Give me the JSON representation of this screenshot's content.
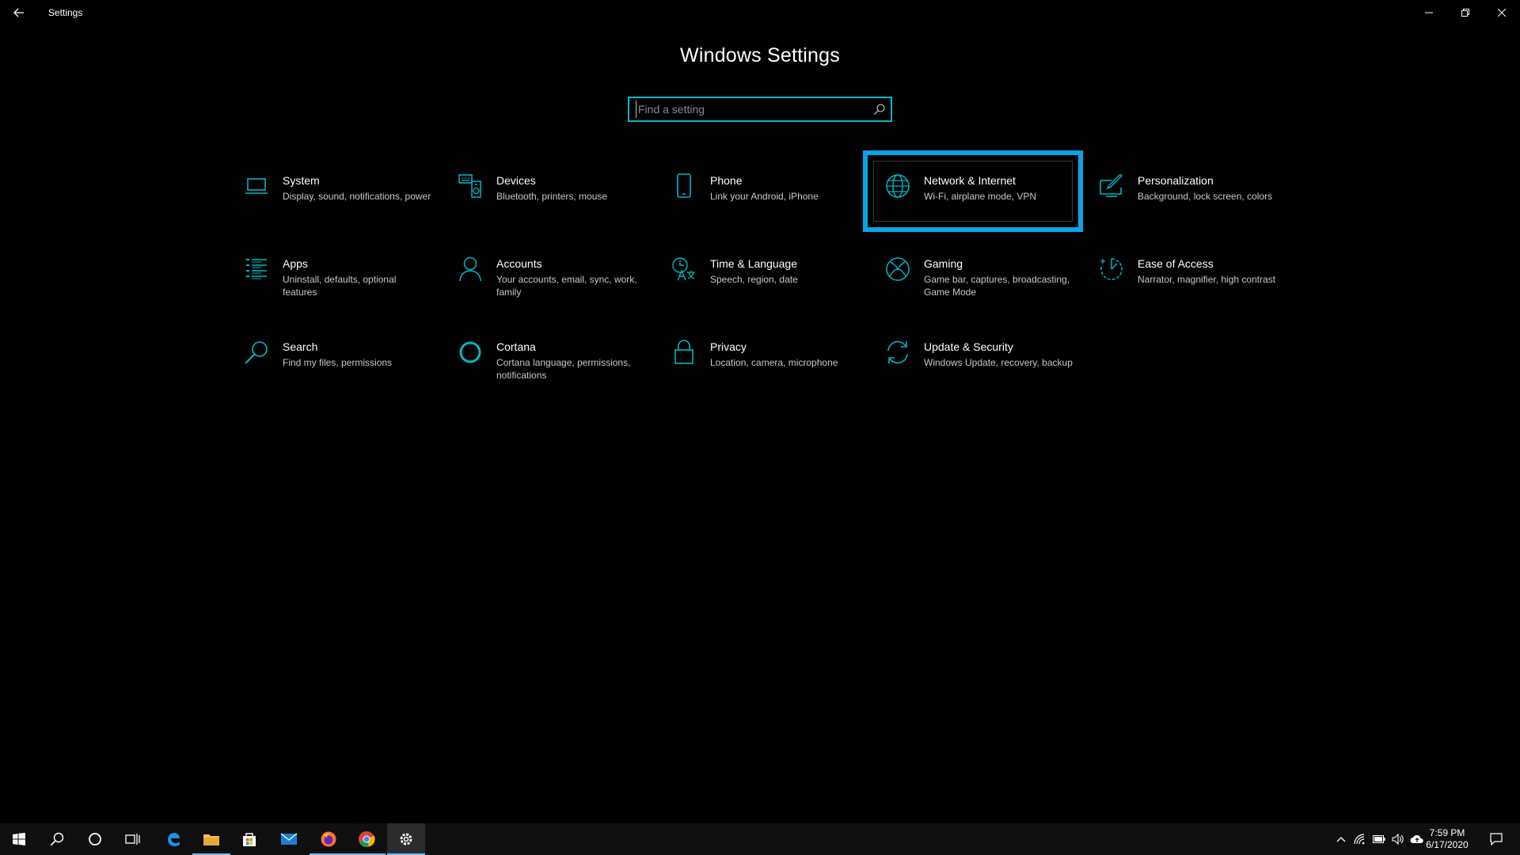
{
  "window": {
    "title": "Settings"
  },
  "page": {
    "heading": "Windows Settings",
    "search_placeholder": "Find a setting"
  },
  "categories": [
    {
      "name": "System",
      "desc": "Display, sound, notifications, power",
      "icon": "laptop-icon"
    },
    {
      "name": "Devices",
      "desc": "Bluetooth, printers, mouse",
      "icon": "keyboard-speaker-icon"
    },
    {
      "name": "Phone",
      "desc": "Link your Android, iPhone",
      "icon": "phone-icon"
    },
    {
      "name": "Network & Internet",
      "desc": "Wi-Fi, airplane mode, VPN",
      "icon": "globe-icon"
    },
    {
      "name": "Personalization",
      "desc": "Background, lock screen, colors",
      "icon": "pen-display-icon"
    },
    {
      "name": "Apps",
      "desc": "Uninstall, defaults, optional features",
      "icon": "list-icon"
    },
    {
      "name": "Accounts",
      "desc": "Your accounts, email, sync, work, family",
      "icon": "person-icon"
    },
    {
      "name": "Time & Language",
      "desc": "Speech, region, date",
      "icon": "time-language-icon"
    },
    {
      "name": "Gaming",
      "desc": "Game bar, captures, broadcasting, Game Mode",
      "icon": "xbox-icon"
    },
    {
      "name": "Ease of Access",
      "desc": "Narrator, magnifier, high contrast",
      "icon": "ease-of-access-icon"
    },
    {
      "name": "Search",
      "desc": "Find my files, permissions",
      "icon": "search-icon"
    },
    {
      "name": "Cortana",
      "desc": "Cortana language, permissions, notifications",
      "icon": "cortana-icon"
    },
    {
      "name": "Privacy",
      "desc": "Location, camera, microphone",
      "icon": "lock-icon"
    },
    {
      "name": "Update & Security",
      "desc": "Windows Update, recovery, backup",
      "icon": "refresh-icon"
    }
  ],
  "highlighted_category": "Network & Internet",
  "taskbar": {
    "apps": [
      {
        "name": "start-button",
        "icon": "windows-logo-icon"
      },
      {
        "name": "search-button",
        "icon": "search-icon"
      },
      {
        "name": "cortana-button",
        "icon": "cortana-circle-icon"
      },
      {
        "name": "task-view-button",
        "icon": "task-view-icon"
      },
      {
        "name": "edge-button",
        "icon": "edge-icon"
      },
      {
        "name": "file-explorer-button",
        "icon": "folder-icon"
      },
      {
        "name": "store-button",
        "icon": "store-icon"
      },
      {
        "name": "mail-button",
        "icon": "mail-icon"
      },
      {
        "name": "firefox-button",
        "icon": "firefox-icon"
      },
      {
        "name": "chrome-button",
        "icon": "chrome-icon"
      },
      {
        "name": "settings-button",
        "icon": "gear-icon"
      }
    ],
    "time": "7:59 PM",
    "date": "6/17/2020"
  },
  "colors": {
    "accent": "#00b7c3",
    "highlight_border": "#0aa3e6",
    "background": "#000000",
    "taskbar": "#0f0f0f"
  }
}
